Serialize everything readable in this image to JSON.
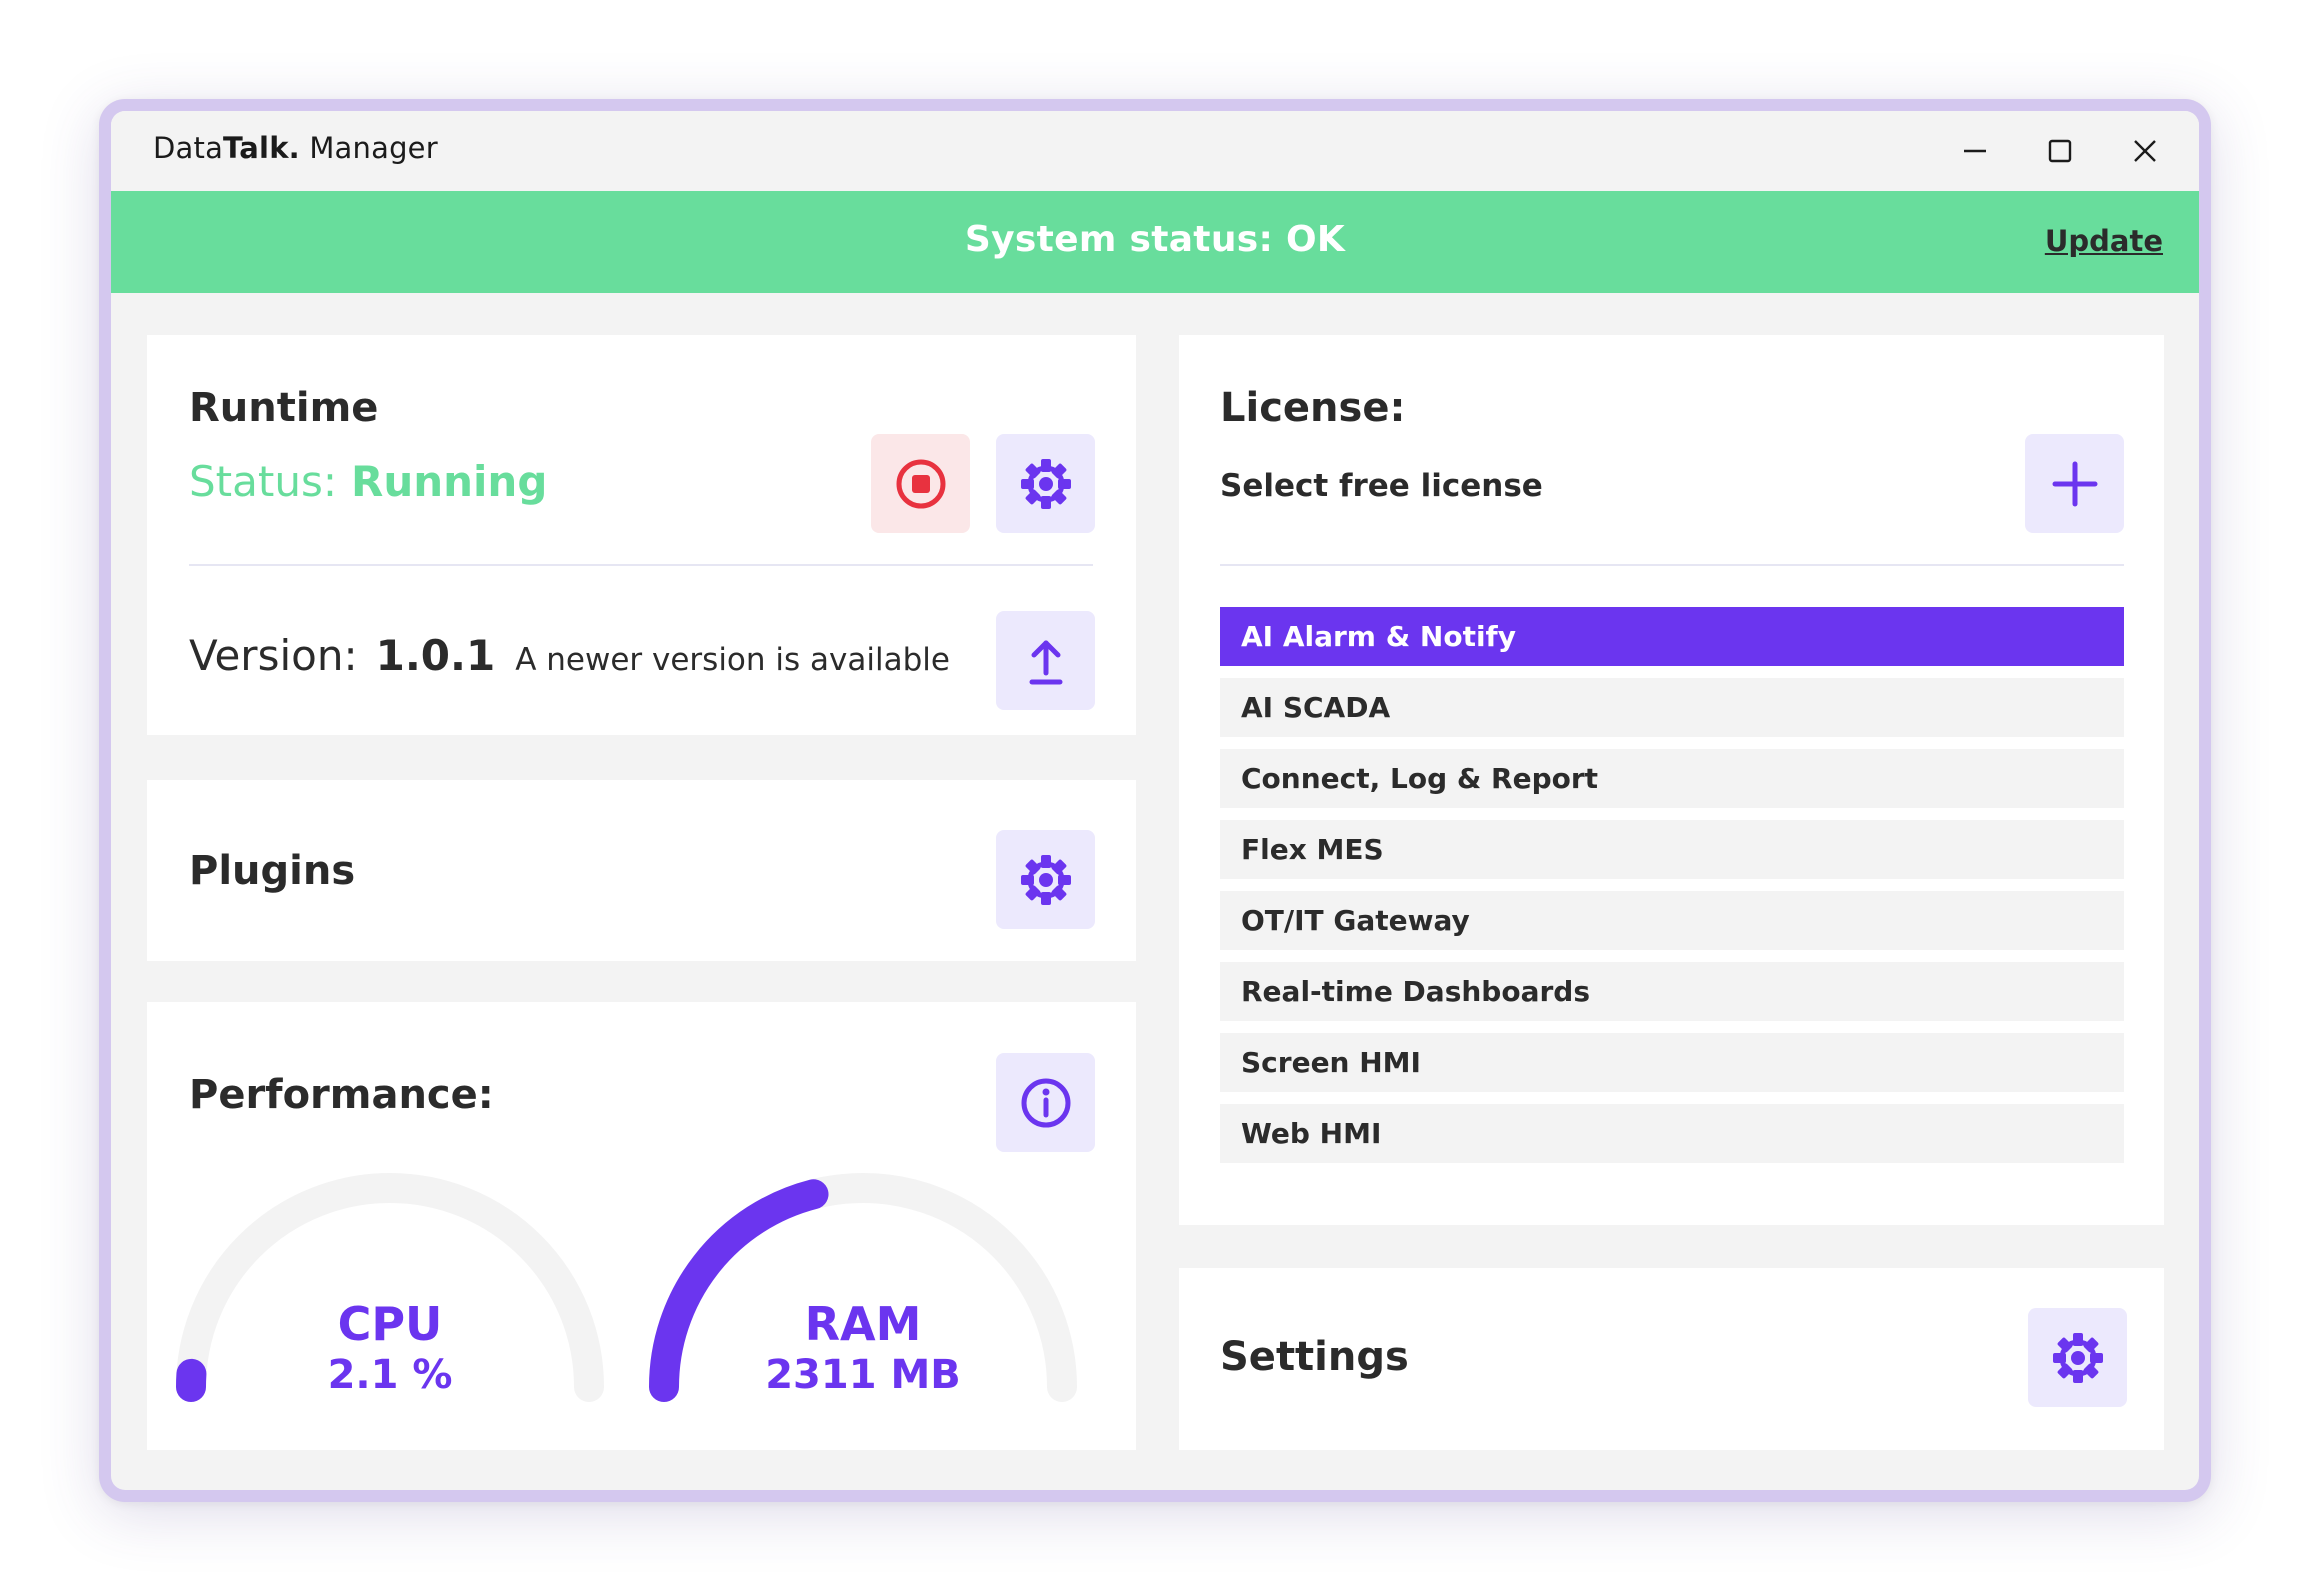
{
  "window": {
    "title_part1": "Data",
    "title_part2": "Talk.",
    "title_part3": "Manager"
  },
  "status_bar": {
    "text": "System status: OK",
    "update_label": "Update",
    "color": "#68dd9c"
  },
  "runtime": {
    "title": "Runtime",
    "status_label": "Status:",
    "status_value": "Running",
    "stop_icon": "stop-icon",
    "settings_icon": "gear-icon",
    "version_label": "Version:",
    "version_value": "1.0.1",
    "version_note": "A newer version is available",
    "update_icon": "upload-arrow-icon"
  },
  "plugins": {
    "title": "Plugins",
    "settings_icon": "gear-icon"
  },
  "performance": {
    "title": "Performance:",
    "info_icon": "info-icon",
    "cpu": {
      "label": "CPU",
      "value": "2.1 %",
      "fraction": 0.021
    },
    "ram": {
      "label": "RAM",
      "value": "2311 MB",
      "fraction": 0.42
    }
  },
  "license": {
    "title": "License:",
    "subtitle": "Select free license",
    "add_icon": "plus-icon",
    "items": [
      {
        "label": "AI Alarm & Notify",
        "selected": true
      },
      {
        "label": "AI SCADA",
        "selected": false
      },
      {
        "label": "Connect, Log & Report",
        "selected": false
      },
      {
        "label": "Flex MES",
        "selected": false
      },
      {
        "label": "OT/IT Gateway",
        "selected": false
      },
      {
        "label": "Real-time Dashboards",
        "selected": false
      },
      {
        "label": "Screen HMI",
        "selected": false
      },
      {
        "label": "Web HMI",
        "selected": false
      }
    ]
  },
  "settings": {
    "title": "Settings",
    "settings_icon": "gear-icon"
  },
  "colors": {
    "accent": "#6b35ef",
    "accent_light": "#ece9fd",
    "success": "#68dd9c",
    "danger": "#e8323f",
    "danger_light": "#fbe7e8",
    "gauge_track": "#f3f3f3"
  }
}
